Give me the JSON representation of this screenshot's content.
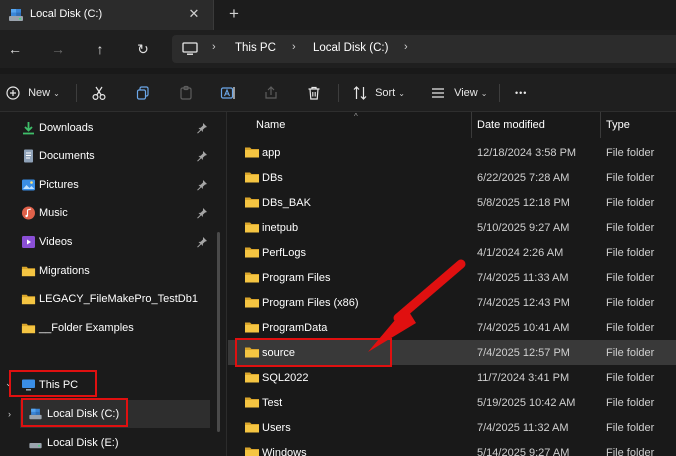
{
  "titlebar": {
    "tab_title": "Local Disk (C:)",
    "close_glyph": "✕",
    "new_tab_glyph": "+"
  },
  "navigation": {
    "back_glyph": "←",
    "forward_glyph": "→",
    "up_glyph": "↑",
    "refresh_glyph": "↻",
    "sep_glyph": "›",
    "breadcrumbs": [
      "This PC",
      "Local Disk (C:)"
    ]
  },
  "commandbar": {
    "new_label": "New",
    "sort_label": "Sort",
    "view_label": "View",
    "more_glyph": "•••",
    "caret_glyph": "⌄"
  },
  "sidebar": {
    "quick_access": [
      {
        "label": "Downloads",
        "icon": "download-icon",
        "pinned": true
      },
      {
        "label": "Documents",
        "icon": "document-icon",
        "pinned": true
      },
      {
        "label": "Pictures",
        "icon": "pictures-icon",
        "pinned": true
      },
      {
        "label": "Music",
        "icon": "music-icon",
        "pinned": true
      },
      {
        "label": "Videos",
        "icon": "videos-icon",
        "pinned": true
      },
      {
        "label": "Migrations",
        "icon": "folder-icon",
        "pinned": false
      },
      {
        "label": "LEGACY_FileMakePro_TestDb1",
        "icon": "folder-icon",
        "pinned": false
      },
      {
        "label": "__Folder Examples",
        "icon": "folder-icon",
        "pinned": false
      }
    ],
    "this_pc": {
      "label": "This PC",
      "chevron": "⌄"
    },
    "local_c": {
      "label": "Local Disk (C:)",
      "chevron": "›"
    },
    "local_e": {
      "label": "Local Disk (E:)"
    }
  },
  "filelist": {
    "headers": {
      "name": "Name",
      "date": "Date modified",
      "type": "Type"
    },
    "sort_glyph": "^",
    "rows": [
      {
        "name": "app",
        "date": "12/18/2024 3:58 PM",
        "type": "File folder"
      },
      {
        "name": "DBs",
        "date": "6/22/2025 7:28 AM",
        "type": "File folder"
      },
      {
        "name": "DBs_BAK",
        "date": "5/8/2025 12:18 PM",
        "type": "File folder"
      },
      {
        "name": "inetpub",
        "date": "5/10/2025 9:27 AM",
        "type": "File folder"
      },
      {
        "name": "PerfLogs",
        "date": "4/1/2024 2:26 AM",
        "type": "File folder"
      },
      {
        "name": "Program Files",
        "date": "7/4/2025 11:33 AM",
        "type": "File folder"
      },
      {
        "name": "Program Files (x86)",
        "date": "7/4/2025 12:43 PM",
        "type": "File folder"
      },
      {
        "name": "ProgramData",
        "date": "7/4/2025 10:41 AM",
        "type": "File folder"
      },
      {
        "name": "source",
        "date": "7/4/2025 12:57 PM",
        "type": "File folder"
      },
      {
        "name": "SQL2022",
        "date": "11/7/2024 3:41 PM",
        "type": "File folder"
      },
      {
        "name": "Test",
        "date": "5/19/2025 10:42 AM",
        "type": "File folder"
      },
      {
        "name": "Users",
        "date": "7/4/2025 11:32 AM",
        "type": "File folder"
      },
      {
        "name": "Windows",
        "date": "5/14/2025 9:27 AM",
        "type": "File folder"
      }
    ]
  },
  "colors": {
    "folder": "#f5c542",
    "annotation": "#e01010",
    "selection": "#393939"
  }
}
